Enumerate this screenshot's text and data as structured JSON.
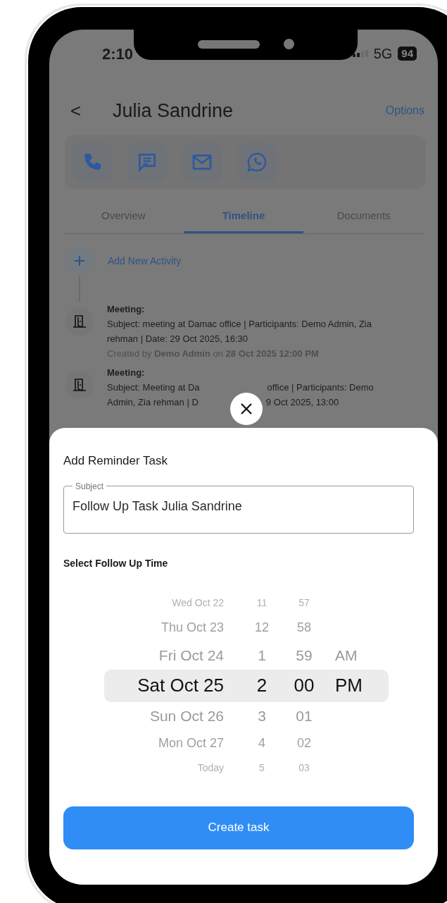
{
  "status_bar": {
    "time": "2:10",
    "network": "5G",
    "battery": "94"
  },
  "header": {
    "back": "<",
    "title": "Julia Sandrine",
    "options": "Options"
  },
  "actions": [
    {
      "kind": "phone"
    },
    {
      "kind": "message"
    },
    {
      "kind": "mail"
    },
    {
      "kind": "whatsapp"
    }
  ],
  "tabs": [
    {
      "label": "Overview",
      "selected": false
    },
    {
      "label": "Timeline",
      "selected": true
    },
    {
      "label": "Documents",
      "selected": false
    }
  ],
  "timeline": {
    "add_label": "Add New Activity",
    "items": [
      {
        "kind": "full",
        "type": "Meeting:",
        "subject": "Subject: meeting at Damac office | Participants: Demo Admin, Zia rehman | Date: 29 Oct 2025, 16:30",
        "created": "Created by **Demo Admin** on **28 Oct 2025 12:00 PM**"
      },
      {
        "kind": "covered",
        "type": "Meeting:",
        "lines": [
          [
            "Subject: Meeting at Da",
            "office | Participants: Demo"
          ],
          [
            "Admin, Zia rehman | D",
            "9 Oct 2025, 13:00"
          ]
        ]
      }
    ]
  },
  "sheet": {
    "title": "Add Reminder Task",
    "subject_label": "Subject",
    "subject_value": "Follow Up Task Julia Sandrine",
    "time_label": "Select Follow Up Time",
    "picker": [
      {
        "date": "Wed Oct 22",
        "hour": "11",
        "minute": "57",
        "selected": false
      },
      {
        "date": "Thu Oct 23",
        "hour": "12",
        "minute": "58",
        "selected": false
      },
      {
        "date": "Fri Oct 24",
        "hour": "1",
        "minute": "59",
        "ampm": "AM",
        "selected": false
      },
      {
        "date": "Sat Oct 25",
        "hour": "2",
        "minute": "00",
        "ampm": "PM",
        "selected": true
      },
      {
        "date": "Sun Oct 26",
        "hour": "3",
        "minute": "01",
        "selected": false
      },
      {
        "date": "Mon Oct 27",
        "hour": "4",
        "minute": "02",
        "selected": false
      },
      {
        "date": "Today",
        "hour": "5",
        "minute": "03",
        "selected": false
      }
    ],
    "button": "Create task"
  }
}
